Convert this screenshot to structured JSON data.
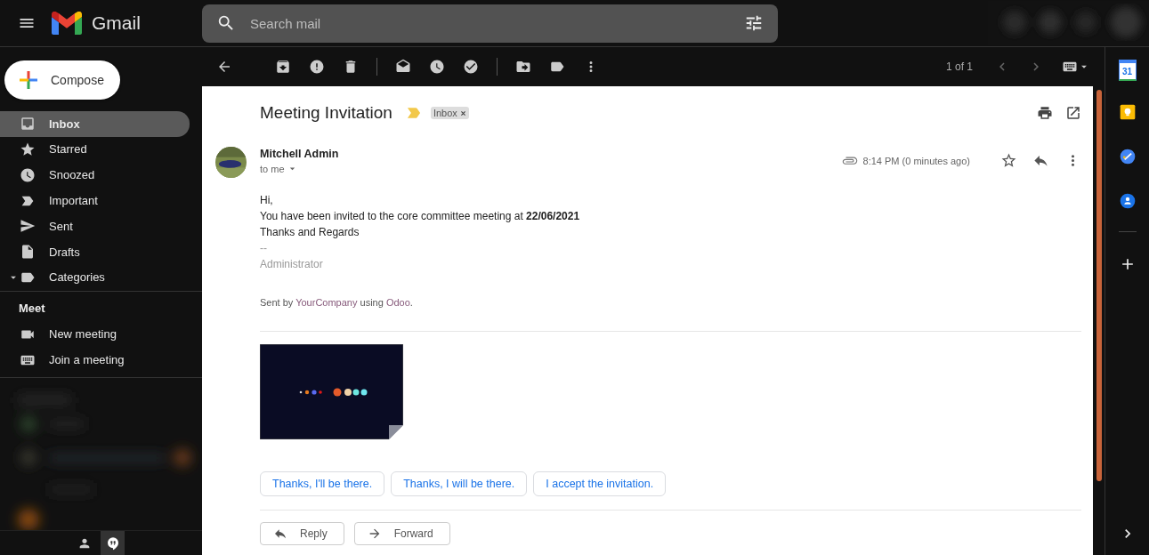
{
  "header": {
    "app_name": "Gmail",
    "search": {
      "placeholder": "Search mail"
    }
  },
  "compose": {
    "label": "Compose"
  },
  "sidebar": {
    "items": [
      {
        "label": "Inbox",
        "kind": "inbox",
        "selected": true
      },
      {
        "label": "Starred",
        "kind": "star",
        "selected": false
      },
      {
        "label": "Snoozed",
        "kind": "clock",
        "selected": false
      },
      {
        "label": "Important",
        "kind": "important",
        "selected": false
      },
      {
        "label": "Sent",
        "kind": "send",
        "selected": false
      },
      {
        "label": "Drafts",
        "kind": "file",
        "selected": false
      },
      {
        "label": "Categories",
        "kind": "category",
        "selected": false
      }
    ],
    "meet": {
      "title": "Meet",
      "items": [
        {
          "label": "New meeting",
          "kind": "video"
        },
        {
          "label": "Join a meeting",
          "kind": "keyboard"
        }
      ]
    }
  },
  "toolbar": {
    "pagination": "1 of 1"
  },
  "message": {
    "subject": "Meeting Invitation",
    "important": true,
    "labels": [
      {
        "label": "Inbox",
        "removable": true
      }
    ],
    "sender": "Mitchell Admin",
    "recipient": "to me",
    "has_attachment": true,
    "time": "8:14 PM (0 minutes ago)",
    "starred": false,
    "body": [
      {
        "kind": "text",
        "text": "Hi,"
      },
      {
        "kind": "text",
        "text": "You have been invited to the core committee meeting at **22/06/2021**"
      },
      {
        "kind": "text",
        "text": "Thanks and Regards"
      },
      {
        "kind": "signature",
        "text": "--"
      },
      {
        "kind": "signature",
        "text": "Administrator"
      }
    ],
    "footer": [
      {
        "kind": "text",
        "text": "Sent by"
      },
      {
        "kind": "link",
        "text": "YourCompany"
      },
      {
        "kind": "text",
        "text": "using"
      },
      {
        "kind": "link",
        "text": "Odoo"
      },
      {
        "kind": "text",
        "text": "."
      }
    ]
  },
  "smart_replies": [
    "Thanks, I'll be there.",
    "Thanks, I will be there.",
    "I accept the invitation."
  ],
  "actions": [
    {
      "kind": "reply",
      "label": "Reply"
    },
    {
      "kind": "forward",
      "label": "Forward"
    }
  ],
  "side_panel": {
    "calendar_day": "31"
  }
}
